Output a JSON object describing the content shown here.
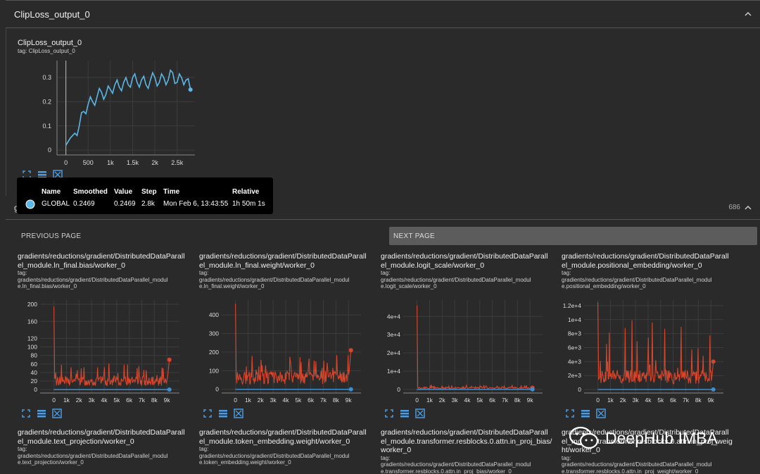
{
  "section1": {
    "title": "ClipLoss_output_0"
  },
  "main_chart": {
    "title": "ClipLoss_output_0",
    "tag": "tag: ClipLoss_output_0",
    "chart_data": {
      "type": "line",
      "x": [
        0,
        100,
        200,
        300,
        400,
        500,
        600,
        700,
        800,
        900,
        1000,
        1100,
        1200,
        1300,
        1400,
        1500,
        1600,
        1700,
        1800,
        1900,
        2000,
        2100,
        2200,
        2300,
        2400,
        2500,
        2600,
        2700,
        2800
      ],
      "series": [
        {
          "values": [
            0.02,
            0.05,
            0.07,
            0.1,
            0.16,
            0.19,
            0.2,
            0.22,
            0.24,
            0.23,
            0.25,
            0.27,
            0.26,
            0.28,
            0.27,
            0.3,
            0.28,
            0.29,
            0.27,
            0.29,
            0.3,
            0.28,
            0.3,
            0.29,
            0.32,
            0.28,
            0.3,
            0.29,
            0.25
          ]
        }
      ],
      "yticks": [
        "0",
        "0.1",
        "0.2",
        "0.3"
      ],
      "xticks": [
        "0",
        "500",
        "1k",
        "1.5k",
        "2k",
        "2.5k"
      ],
      "ylim": [
        -0.02,
        0.37
      ],
      "xlim": [
        -200,
        2900
      ],
      "color": "#5bb7e6"
    }
  },
  "tooltip": {
    "headers": [
      "Name",
      "Smoothed",
      "Value",
      "Step",
      "Time",
      "Relative"
    ],
    "values": [
      "GLOBAL",
      "0.2469",
      "0.2469",
      "2.8k",
      "Mon Feb 6, 13:43:55",
      "1h 50m 1s"
    ],
    "dot_color": "#5bb7e6"
  },
  "section2": {
    "title": "g",
    "count": "686"
  },
  "pager": {
    "prev": "PREVIOUS PAGE",
    "next": "NEXT PAGE"
  },
  "grad_cards": [
    {
      "title": "gradients/reductions/gradient/DistributedDataParallel_module.ln_final.bias/worker_0",
      "title_lines": [
        "gradients/reductions/gradient/DistributedDataParall",
        "el_module.ln_final.bias/worker_0"
      ],
      "tag_lines": [
        "tag:",
        "gradients/reductions/gradient/DistributedDataParallel_modul",
        "e.ln_final.bias/worker_0"
      ],
      "chart_data": {
        "type": "line",
        "yticks": [
          "0",
          "20",
          "40",
          "60",
          "80",
          "100",
          "120",
          "160",
          "200"
        ],
        "ytick_vals": [
          0,
          20,
          40,
          60,
          80,
          100,
          120,
          160,
          200
        ],
        "ylim": [
          -8,
          210
        ],
        "spike": 195,
        "base": 22,
        "end": 70,
        "xticks": [
          "0",
          "1k",
          "2k",
          "3k",
          "4k",
          "5k",
          "6k",
          "7k",
          "8k",
          "9k"
        ]
      }
    },
    {
      "title": "gradients/reductions/gradient/DistributedDataParallel_module.ln_final.weight/worker_0",
      "title_lines": [
        "gradients/reductions/gradient/DistributedDataParall",
        "el_module.ln_final.weight/worker_0"
      ],
      "tag_lines": [
        "tag:",
        "gradients/reductions/gradient/DistributedDataParallel_modul",
        "e.ln_final.weight/worker_0"
      ],
      "chart_data": {
        "type": "line",
        "yticks": [
          "0",
          "100",
          "200",
          "300",
          "400"
        ],
        "ytick_vals": [
          0,
          100,
          200,
          300,
          400
        ],
        "ylim": [
          -20,
          480
        ],
        "spike": 460,
        "base": 70,
        "end": 210,
        "xticks": [
          "0",
          "1k",
          "2k",
          "3k",
          "4k",
          "5k",
          "6k",
          "7k",
          "8k",
          "9k"
        ]
      }
    },
    {
      "title": "gradients/reductions/gradient/DistributedDataParallel_module.logit_scale/worker_0",
      "title_lines": [
        "gradients/reductions/gradient/DistributedDataParall",
        "el_module.logit_scale/worker_0"
      ],
      "tag_lines": [
        "tag:",
        "gradients/reductions/gradient/DistributedDataParallel_modul",
        "e.logit_scale/worker_0"
      ],
      "chart_data": {
        "type": "line",
        "yticks": [
          "0",
          "1e+4",
          "2e+4",
          "3e+4",
          "4e+4"
        ],
        "ytick_vals": [
          0,
          10000,
          20000,
          30000,
          40000
        ],
        "ylim": [
          -2000,
          49000
        ],
        "spike": 46000,
        "base": 900,
        "end": 900,
        "xticks": [
          "0",
          "1k",
          "2k",
          "3k",
          "4k",
          "5k",
          "6k",
          "7k",
          "8k",
          "9k"
        ]
      }
    },
    {
      "title": "gradients/reductions/gradient/DistributedDataParallel_module.positional_embedding/worker_0",
      "title_lines": [
        "gradients/reductions/gradient/DistributedDataParall",
        "el_module.positional_embedding/worker_0"
      ],
      "tag_lines": [
        "tag:",
        "gradients/reductions/gradient/DistributedDataParallel_modul",
        "e.positional_embedding/worker_0"
      ],
      "chart_data": {
        "type": "line",
        "yticks": [
          "0",
          "2e+3",
          "4e+3",
          "6e+3",
          "8e+3",
          "1e+4",
          "1.2e+4"
        ],
        "ytick_vals": [
          0,
          2000,
          4000,
          6000,
          8000,
          10000,
          12000
        ],
        "ylim": [
          -500,
          12800
        ],
        "spike": 12500,
        "base": 2000,
        "end": 4000,
        "xticks": [
          "0",
          "1k",
          "2k",
          "3k",
          "4k",
          "5k",
          "6k",
          "7k",
          "8k",
          "9k"
        ]
      }
    }
  ],
  "grad_cards_row2": [
    {
      "title_lines": [
        "gradients/reductions/gradient/DistributedDataParall",
        "el_module.text_projection/worker_0"
      ],
      "tag_lines": [
        "tag:",
        "gradients/reductions/gradient/DistributedDataParallel_modul",
        "e.text_projection/worker_0"
      ]
    },
    {
      "title_lines": [
        "gradients/reductions/gradient/DistributedDataParall",
        "el_module.token_embedding.weight/worker_0"
      ],
      "tag_lines": [
        "tag:",
        "gradients/reductions/gradient/DistributedDataParallel_modul",
        "e.token_embedding.weight/worker_0"
      ]
    },
    {
      "title_lines": [
        "gradients/reductions/gradient/DistributedDataParall",
        "el_module.transformer.resblocks.0.attn.in_proj_bias/",
        "worker_0"
      ],
      "tag_lines": [
        "tag:",
        "gradients/reductions/gradient/DistributedDataParallel_modul",
        "e.transformer.resblocks.0.attn.in_proj_bias/worker_0"
      ]
    },
    {
      "title_lines": [
        "gradients/reductions/gradient/DistributedDataParall",
        "el_module.transformer.resblocks.0.attn.in_proj_weig",
        "ht/worker_0"
      ],
      "tag_lines": [
        "tag:",
        "gradients/reductions/gradient/DistributedDataParallel_modul",
        "e.transformer.resblocks.0.attn.in_proj_weight/worker_0"
      ]
    }
  ],
  "watermark": {
    "text": "DeepHub IMBA",
    "icon": "wechat-icon"
  },
  "colors": {
    "accent_line": "#5bb7e6",
    "grad_line": "#d9452b",
    "grad_smoothed": "#3d8fd0"
  }
}
